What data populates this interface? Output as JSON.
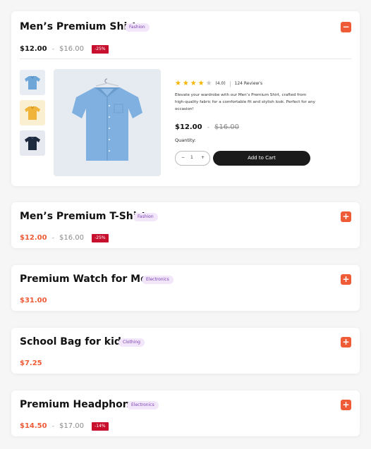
{
  "products": [
    {
      "title": "Men’s Premium Shirt",
      "category": "Fashion",
      "price": "$12.00",
      "separator": "-",
      "old_price": "$16.00",
      "discount": "-25%",
      "toggle": "−",
      "expanded": true,
      "rating_value": "(4.0)",
      "rating_stars": 4,
      "reviews": "124 Review's",
      "description": "Elevate your wardrobe with our Men’s Premium Shirt, crafted from high-quality fabric for a comfortable fit and stylish look. Perfect for any occasion!",
      "quantity_label": "Quantity:",
      "quantity": "1",
      "minus": "−",
      "plus": "+",
      "add_to_cart": "Add to Cart"
    },
    {
      "title": "Men’s Premium T-Shirt",
      "category": "Fashion",
      "price": "$12.00",
      "separator": "-",
      "old_price": "$16.00",
      "discount": "-25%",
      "toggle": "+"
    },
    {
      "title": "Premium Watch for Men",
      "category": "Electronics",
      "price": "$31.00",
      "toggle": "+"
    },
    {
      "title": "School Bag for kids",
      "category": "Clothing",
      "price": "$7.25",
      "toggle": "+"
    },
    {
      "title": "Premium Headphone",
      "category": "Electronics",
      "price": "$14.50",
      "separator": "-",
      "old_price": "$17.00",
      "discount": "-14%",
      "toggle": "+"
    }
  ],
  "colors": {
    "accent": "#ee5b36",
    "discount_bg": "#c8102e",
    "badge_bg": "#f2e6fb",
    "badge_text": "#7a3fb0",
    "star": "#f4b400",
    "cart_button": "#1b1b1b"
  },
  "icons": {
    "collapse": "minus-icon",
    "expand": "plus-icon",
    "star": "star-icon"
  }
}
